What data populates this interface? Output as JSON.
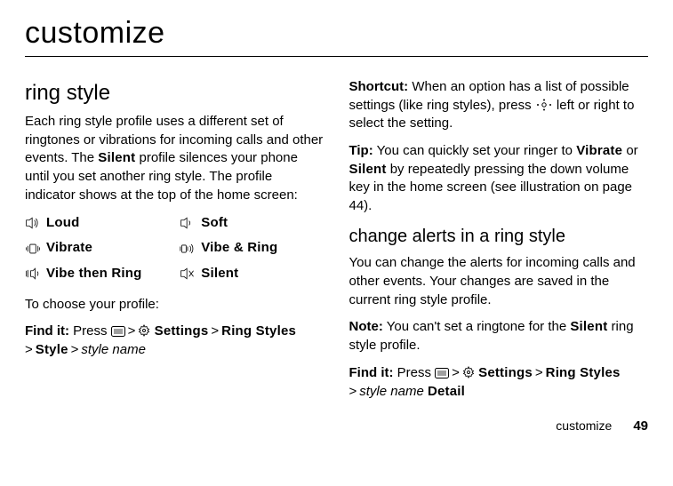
{
  "title": "customize",
  "left": {
    "heading": "ring style",
    "intro_a": "Each ring style profile uses a different set of ringtones or vibrations for incoming calls and other events. The ",
    "intro_silent": "Silent",
    "intro_b": " profile silences your phone until you set another ring style. The profile indicator shows at the top of the home screen:",
    "styles": [
      {
        "id": "loud",
        "label": "Loud"
      },
      {
        "id": "soft",
        "label": "Soft"
      },
      {
        "id": "vibrate",
        "label": "Vibrate"
      },
      {
        "id": "vibe-ring",
        "label": "Vibe & Ring"
      },
      {
        "id": "vibe-then-ring",
        "label": "Vibe then Ring"
      },
      {
        "id": "silent",
        "label": "Silent"
      }
    ],
    "choose": "To choose your profile:",
    "findit_label": "Find it:",
    "findit_press": " Press ",
    "path": {
      "settings": "Settings",
      "ring_styles": "Ring Styles",
      "style": "Style",
      "style_name": "style name"
    }
  },
  "right": {
    "shortcut_label": "Shortcut:",
    "shortcut_text": " When an option has a list of possible settings (like ring styles), press ",
    "shortcut_tail": " left or right to select the setting.",
    "tip_label": "Tip:",
    "tip_a": " You can quickly set your ringer to ",
    "tip_vibrate": "Vibrate",
    "tip_or": " or ",
    "tip_silent": "Silent",
    "tip_b": " by repeatedly pressing the down volume key in the home screen (see illustration on page 44).",
    "subheading": "change alerts in a ring style",
    "change_intro": "You can change the alerts for incoming calls and other events. Your changes are saved in the current ring style profile.",
    "note_label": "Note:",
    "note_a": " You can't set a ringtone for the ",
    "note_silent": "Silent",
    "note_b": " ring style profile.",
    "findit_label": "Find it:",
    "findit_press": " Press ",
    "path": {
      "settings": "Settings",
      "ring_styles": "Ring Styles",
      "style_name": "style name",
      "detail": "Detail"
    }
  },
  "footer": {
    "section": "customize",
    "page": "49"
  },
  "sep": ">"
}
